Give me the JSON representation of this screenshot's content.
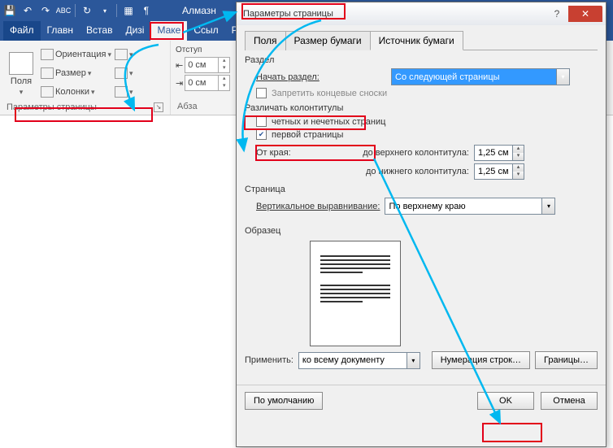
{
  "qat": {
    "title": "Алмазн"
  },
  "tabs": {
    "file": "Файл",
    "items": [
      "Главн",
      "Встав",
      "Дизі",
      "Маке",
      "Ссыл",
      "Расс"
    ],
    "active_index": 3
  },
  "ribbon": {
    "group_page": {
      "margins": "Поля",
      "orientation": "Ориентация",
      "size": "Размер",
      "columns": "Колонки",
      "footer": "Параметры страницы"
    },
    "group_par": {
      "indent_label": "Отступ",
      "left_value": "0 см",
      "right_value": "0 см",
      "footer": "Абза"
    }
  },
  "dialog": {
    "title": "Параметры страницы",
    "tabs": {
      "fields": "Поля",
      "paper_size": "Размер бумаги",
      "paper_source": "Источник бумаги",
      "active": 2
    },
    "section": {
      "label": "Раздел",
      "start_label": "Начать раздел:",
      "start_value": "Со следующей страницы",
      "suppress_endnotes": "Запретить концевые сноски",
      "suppress_checked": false
    },
    "headers": {
      "label": "Различать колонтитулы",
      "odd_even": "четных и нечетных страниц",
      "odd_even_checked": false,
      "first_page": "первой страницы",
      "first_page_checked": true,
      "from_edge": "От края:",
      "header_label": "до верхнего колонтитула:",
      "header_value": "1,25 см",
      "footer_label": "до нижнего колонтитула:",
      "footer_value": "1,25 см"
    },
    "page": {
      "label": "Страница",
      "valign_label": "Вертикальное выравнивание:",
      "valign_value": "По верхнему краю"
    },
    "preview_label": "Образец",
    "apply": {
      "label": "Применить:",
      "value": "ко всему документу"
    },
    "buttons": {
      "line_numbers": "Нумерация строк…",
      "borders": "Границы…",
      "default": "По умолчанию",
      "ok": "OK",
      "cancel": "Отмена"
    }
  }
}
